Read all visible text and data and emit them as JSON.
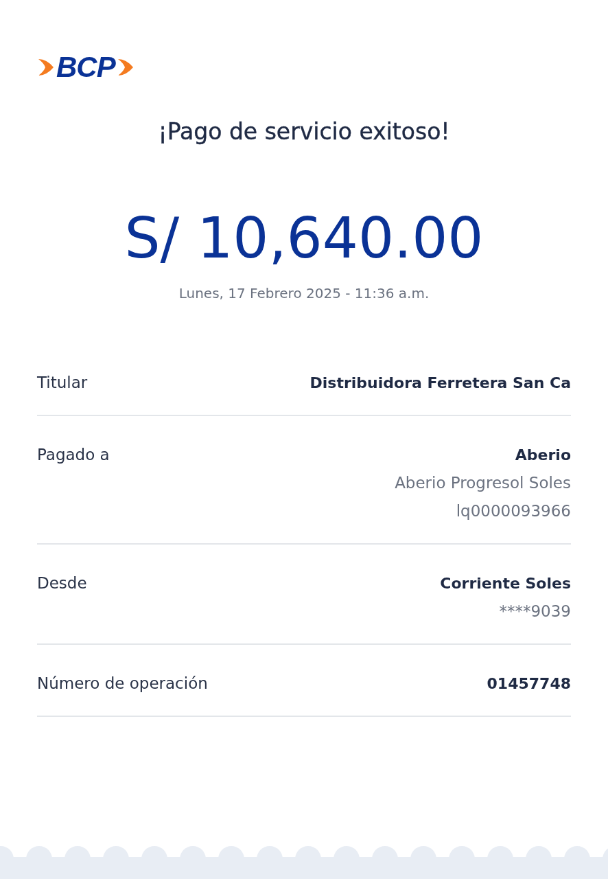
{
  "logo": {
    "text": "BCP"
  },
  "title": "¡Pago de servicio exitoso!",
  "amount": "S/ 10,640.00",
  "datetime": "Lunes, 17 Febrero 2025 - 11:36 a.m.",
  "rows": [
    {
      "label": "Titular",
      "values": [
        {
          "text": "Distribuidora Ferretera San Ca",
          "kind": "primary"
        }
      ]
    },
    {
      "label": "Pagado a",
      "values": [
        {
          "text": "Aberio",
          "kind": "primary"
        },
        {
          "text": "Aberio Progresol Soles",
          "kind": "secondary"
        },
        {
          "text": "lq0000093966",
          "kind": "secondary"
        }
      ]
    },
    {
      "label": "Desde",
      "values": [
        {
          "text": "Corriente Soles",
          "kind": "primary"
        },
        {
          "text": "****9039",
          "kind": "secondary"
        }
      ]
    },
    {
      "label": "Número de operación",
      "values": [
        {
          "text": "01457748",
          "kind": "primary"
        }
      ]
    }
  ]
}
